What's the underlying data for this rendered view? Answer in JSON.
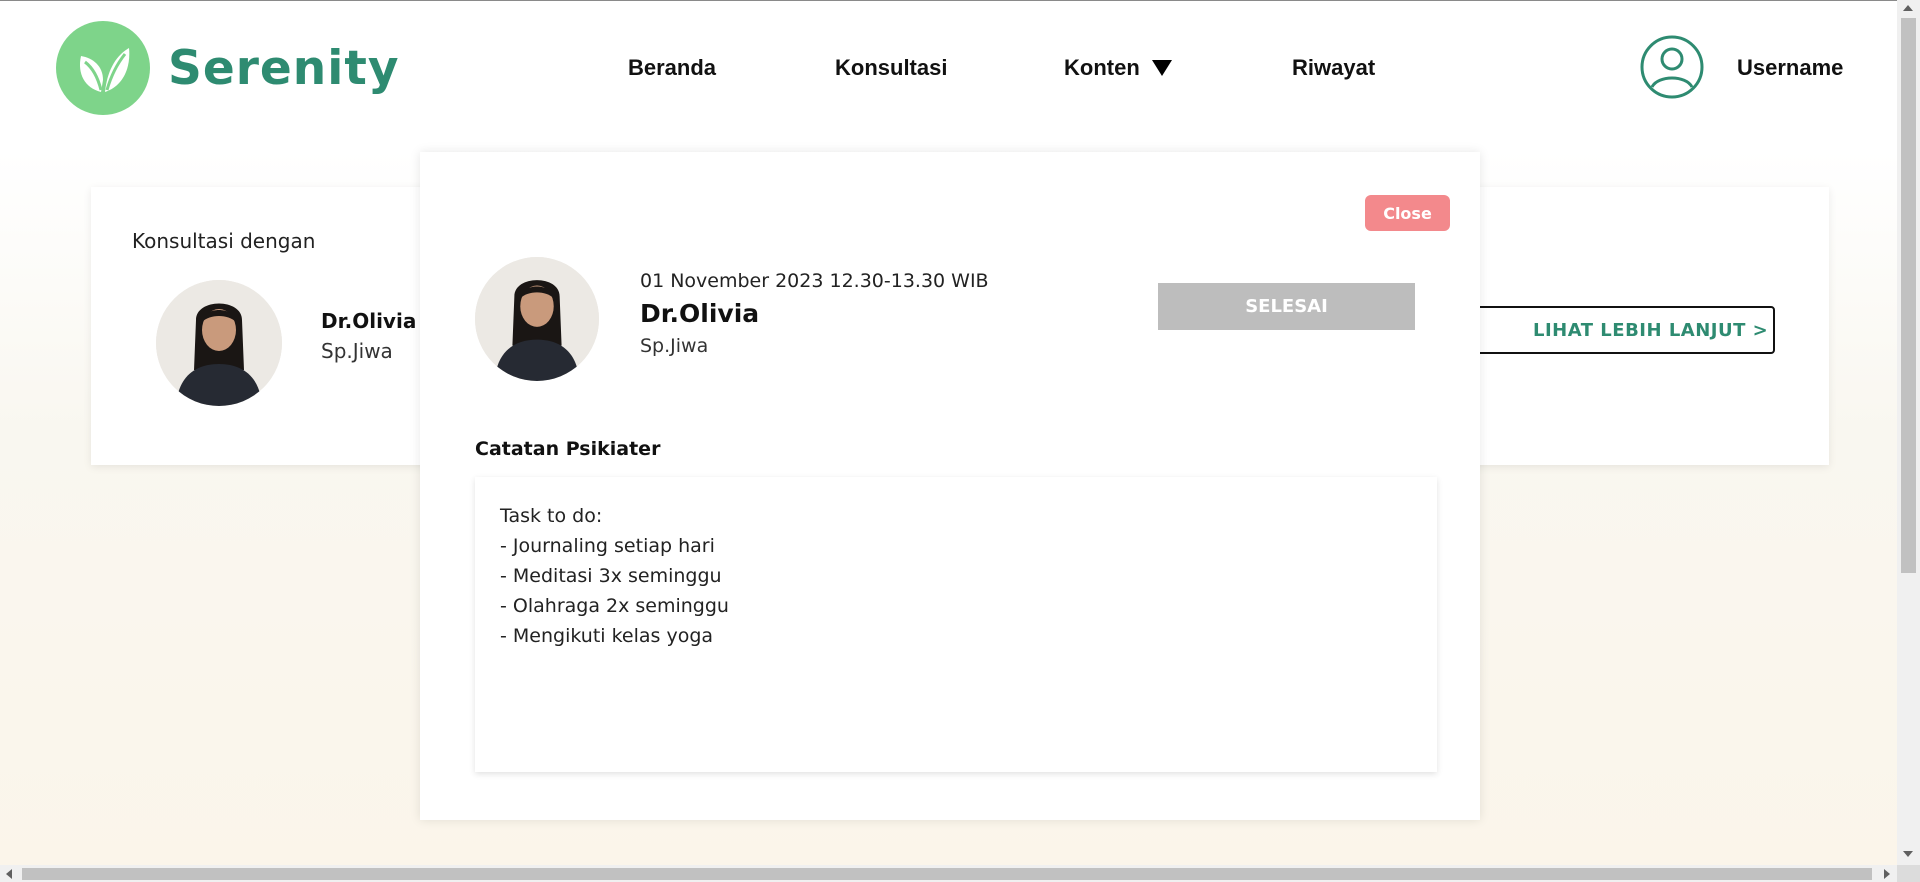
{
  "app": {
    "brand": "Serenity",
    "brand_color": "#2e8b71",
    "logo_color": "#7ed48a"
  },
  "nav": {
    "beranda": "Beranda",
    "konsultasi": "Konsultasi",
    "konten": "Konten",
    "riwayat": "Riwayat",
    "username": "Username"
  },
  "background_card": {
    "title": "Konsultasi dengan",
    "doctor_name": "Dr.Olivia",
    "doctor_spec": "Sp.Jiwa",
    "button_label": "LIHAT LEBIH LANJUT   >"
  },
  "modal": {
    "close_label": "Close",
    "date": "01 November 2023 12.30-13.30 WIB",
    "doctor_name": "Dr.Olivia",
    "doctor_spec": "Sp.Jiwa",
    "status_label": "SELESAI",
    "notes_title": "Catatan Psikiater",
    "notes": [
      "Task to do:",
      "- Journaling setiap hari",
      "- Meditasi 3x seminggu",
      "- Olahraga 2x seminggu",
      "- Mengikuti kelas yoga"
    ],
    "close_color": "#f3898c",
    "status_color": "#bdbdbd"
  },
  "icons": {
    "logo": "leaf-icon",
    "nav_dropdown": "caret-down-icon",
    "user": "user-circle-icon",
    "avatar": "doctor-avatar"
  }
}
